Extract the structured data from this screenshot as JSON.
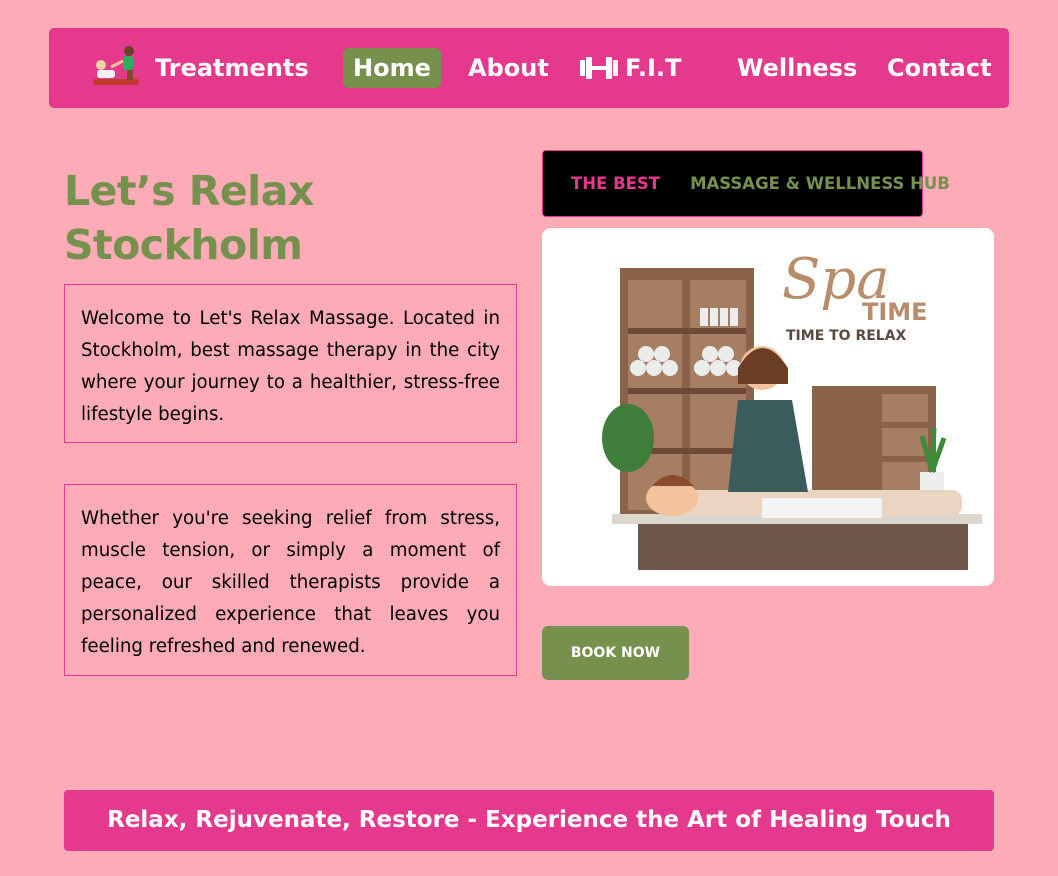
{
  "nav": {
    "logo_icon": "massage-therapy-logo",
    "items": [
      {
        "label": "Treatments"
      },
      {
        "label": "Home"
      },
      {
        "label": "About"
      },
      {
        "label": "F.I.T",
        "icon": "dumbbell-icon"
      },
      {
        "label": "Wellness"
      },
      {
        "label": "Contact"
      }
    ]
  },
  "hero": {
    "title_line1": "Let’s Relax",
    "title_line2": "Stockholm"
  },
  "intro": {
    "paragraph1": "Welcome to Let's Relax Massage. Located in Stockholm, best massage therapy in the city where your journey to a healthier, stress-free lifestyle begins.",
    "paragraph2": "Whether you're seeking relief from stress, muscle tension, or simply a moment of peace, our skilled therapists provide a personalized experience that leaves you feeling refreshed and renewed."
  },
  "tagline": {
    "part1": "THE BEST",
    "part2": "MASSAGE & WELLNESS HUB"
  },
  "illustration": {
    "title_word": "Spa",
    "title_word2": "TIME",
    "subtitle": "TIME TO RELAX"
  },
  "cta": {
    "book_label": "BOOK NOW"
  },
  "footer": {
    "text": "Relax, Rejuvenate, Restore - Experience the Art of Healing Touch"
  },
  "colors": {
    "background": "#fdabb7",
    "brand_pink": "#e4398c",
    "brand_green": "#76904d"
  }
}
